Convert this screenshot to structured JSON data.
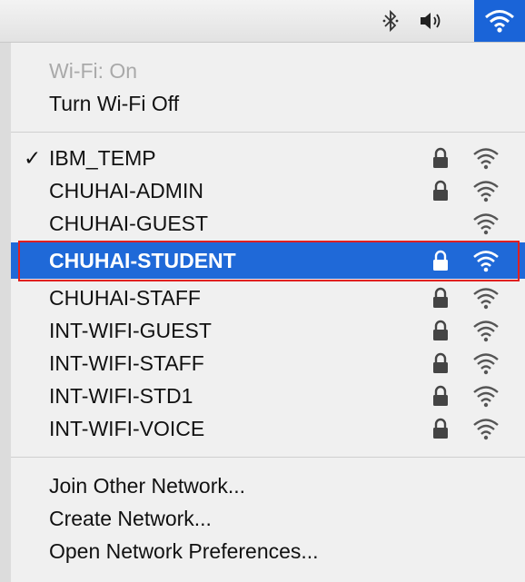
{
  "menubar": {
    "icons": [
      "bluetooth-icon",
      "volume-icon",
      "wifi-icon"
    ],
    "wifi_active_color": "#1a64d8"
  },
  "wifi_menu": {
    "status": "Wi-Fi: On",
    "toggle": "Turn Wi-Fi Off",
    "networks": [
      {
        "name": "IBM_TEMP",
        "connected": true,
        "locked": true
      },
      {
        "name": "CHUHAI-ADMIN",
        "connected": false,
        "locked": true
      },
      {
        "name": "CHUHAI-GUEST",
        "connected": false,
        "locked": false
      },
      {
        "name": "CHUHAI-STUDENT",
        "connected": false,
        "locked": true,
        "highlighted": true
      },
      {
        "name": "CHUHAI-STAFF",
        "connected": false,
        "locked": true
      },
      {
        "name": "INT-WIFI-GUEST",
        "connected": false,
        "locked": true
      },
      {
        "name": "INT-WIFI-STAFF",
        "connected": false,
        "locked": true
      },
      {
        "name": "INT-WIFI-STD1",
        "connected": false,
        "locked": true
      },
      {
        "name": "INT-WIFI-VOICE",
        "connected": false,
        "locked": true
      }
    ],
    "connected_mark": "✓",
    "actions": {
      "join_other": "Join Other Network...",
      "create": "Create Network...",
      "preferences": "Open Network Preferences..."
    },
    "highlight_color": "#1f69d8",
    "annotation_color": "#e02020"
  }
}
